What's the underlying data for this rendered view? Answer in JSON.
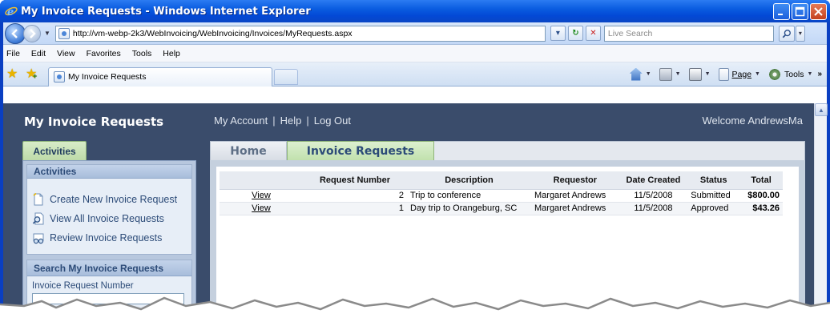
{
  "window": {
    "title": "My Invoice Requests - Windows Internet Explorer"
  },
  "address_bar": {
    "url": "http://vm-webp-2k3/WebInvoicing/WebInvoicing/Invoices/MyRequests.aspx",
    "search_placeholder": "Live Search"
  },
  "menu": {
    "items": [
      "File",
      "Edit",
      "View",
      "Favorites",
      "Tools",
      "Help"
    ]
  },
  "tab_bar": {
    "tab_title": "My Invoice Requests",
    "page_label": "Page",
    "tools_label": "Tools"
  },
  "app": {
    "title": "My Invoice Requests",
    "links": [
      "My Account",
      "Help",
      "Log Out"
    ],
    "welcome": "Welcome AndrewsMa"
  },
  "sidebar": {
    "tab_label": "Activities",
    "panel_title": "Activities",
    "items": [
      {
        "label": "Create New Invoice Request",
        "icon": "new-document-icon"
      },
      {
        "label": "View All Invoice Requests",
        "icon": "magnifier-document-icon"
      },
      {
        "label": "Review Invoice Requests",
        "icon": "review-glasses-icon"
      }
    ],
    "search_title": "Search My Invoice Requests",
    "search_field_label": "Invoice Request Number"
  },
  "main": {
    "tabs": [
      {
        "label": "Home",
        "active": false
      },
      {
        "label": "Invoice Requests",
        "active": true
      }
    ],
    "table": {
      "columns": [
        "",
        "Request Number",
        "Description",
        "Requestor",
        "Date Created",
        "Status",
        "Total"
      ],
      "rows": [
        {
          "action": "View",
          "request_number": "2",
          "description": "Trip to conference",
          "requestor": "Margaret Andrews",
          "date_created": "11/5/2008",
          "status": "Submitted",
          "total": "$800.00"
        },
        {
          "action": "View",
          "request_number": "1",
          "description": "Day trip to Orangeburg, SC",
          "requestor": "Margaret Andrews",
          "date_created": "11/5/2008",
          "status": "Approved",
          "total": "$43.26"
        }
      ]
    }
  },
  "colors": {
    "titlebar": "#0a5ce0",
    "page_bg": "#3a4c6b",
    "active_tab": "#c1e1ad",
    "link_text": "#2c4b78"
  }
}
